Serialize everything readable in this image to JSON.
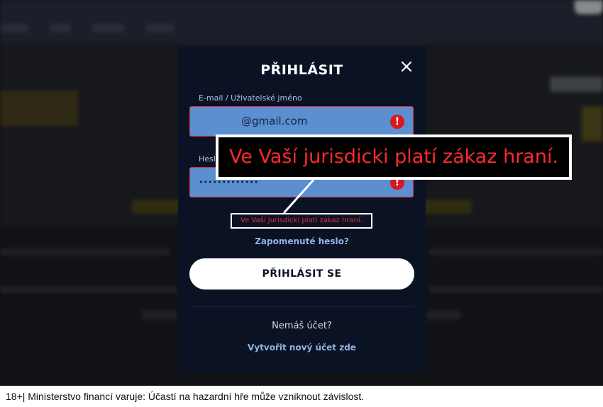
{
  "modal": {
    "title": "PŘIHLÁSIT",
    "email_label": "E-mail / Uživatelské jméno",
    "email_value": "@gmail.com",
    "password_label": "Heslo",
    "password_value": "•••••••••••••",
    "inline_error": "Ve Vaší jurisdicki platí zákaz hraní.",
    "forgot_password": "Zapomenuté heslo?",
    "login_button": "PŘIHLÁSIT SE",
    "no_account": "Nemáš účet?",
    "register_link": "Vytvořit nový účet zde"
  },
  "annotation": {
    "callout_text": "Ve Vaší jurisdicki platí zákaz hraní."
  },
  "footer": {
    "disclaimer": "18+| Ministerstvo financí varuje: Účastí na hazardní hře může vzniknout závislost."
  },
  "icons": {
    "close": "close-icon",
    "error": "error-icon"
  },
  "colors": {
    "modal_bg": "#0a1224",
    "field_bg": "#5b8fd0",
    "error_red": "#d8171f",
    "link_blue": "#8fb4e4"
  }
}
